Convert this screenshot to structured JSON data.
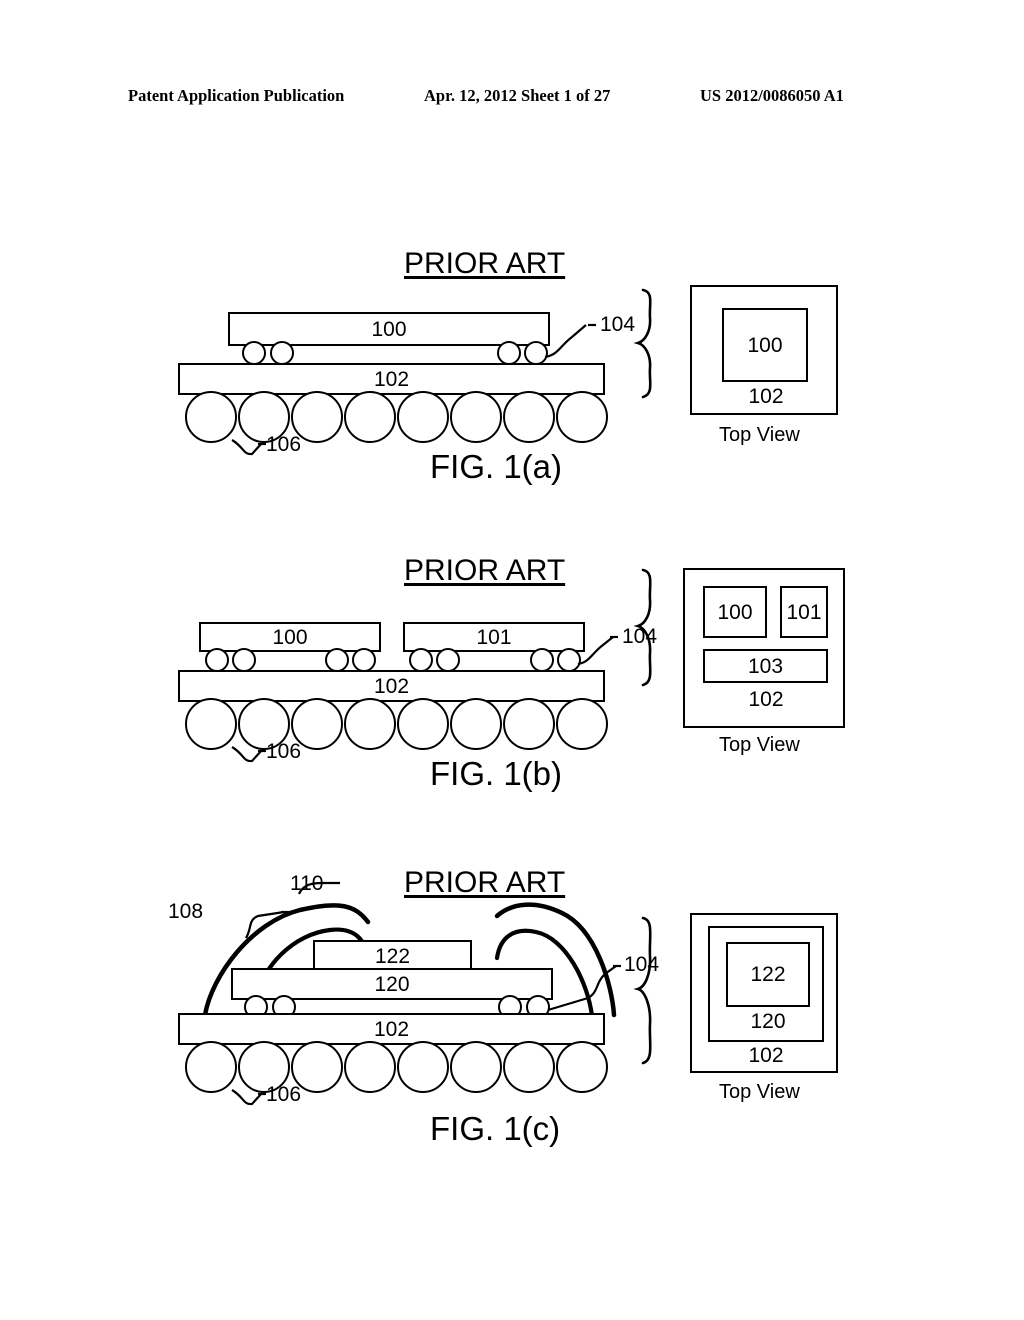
{
  "header": {
    "left": "Patent Application Publication",
    "middle": "Apr. 12, 2012  Sheet 1 of 27",
    "right": "US 2012/0086050 A1"
  },
  "figures": [
    {
      "id": "fig-1a",
      "prior_art": "PRIOR ART",
      "caption": "FIG. 1(a)",
      "top_view_label": "Top View",
      "cross_section": {
        "die_top": "100",
        "substrate": "102",
        "ref_bump": "104",
        "ref_ball": "106"
      },
      "top_view": {
        "outer": "102",
        "inner": "100"
      }
    },
    {
      "id": "fig-1b",
      "prior_art": "PRIOR ART",
      "caption": "FIG. 1(b)",
      "top_view_label": "Top View",
      "cross_section": {
        "die_left": "100",
        "die_right": "101",
        "substrate": "102",
        "ref_bump": "104",
        "ref_ball": "106"
      },
      "top_view": {
        "outer": "102",
        "box_a": "100",
        "box_b": "101",
        "box_c": "103"
      }
    },
    {
      "id": "fig-1c",
      "prior_art": "PRIOR ART",
      "caption": "FIG. 1(c)",
      "top_view_label": "Top View",
      "cross_section": {
        "die_top": "122",
        "interposer": "120",
        "substrate": "102",
        "ref_mold": "108",
        "ref_wire": "110",
        "ref_bump": "104",
        "ref_ball": "106"
      },
      "top_view": {
        "outer": "102",
        "middle": "120",
        "inner": "122"
      }
    }
  ],
  "colors": {
    "ink": "#000000",
    "paper": "#ffffff"
  }
}
